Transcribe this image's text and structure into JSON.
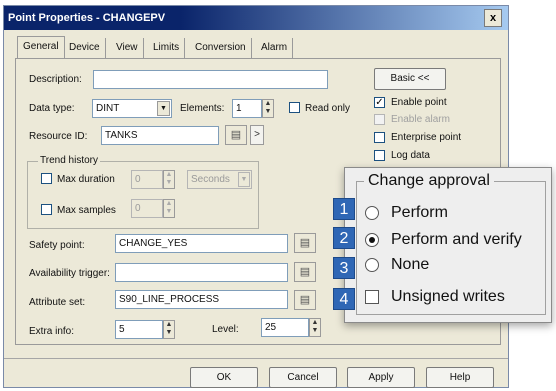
{
  "window": {
    "title": "Point Properties - CHANGEPV",
    "close_glyph": "x"
  },
  "tabs": [
    {
      "label": "General",
      "active": true
    },
    {
      "label": "Device"
    },
    {
      "label": "View"
    },
    {
      "label": "Limits"
    },
    {
      "label": "Conversion"
    },
    {
      "label": "Alarm"
    }
  ],
  "form": {
    "description_label": "Description:",
    "description_value": "",
    "basic_button": "Basic <<",
    "data_type_label": "Data type:",
    "data_type_value": "DINT",
    "elements_label": "Elements:",
    "elements_value": "1",
    "read_only_label": "Read only",
    "resource_id_label": "Resource ID:",
    "resource_id_value": "TANKS",
    "trend_history_label": "Trend history",
    "max_duration_label": "Max duration",
    "max_duration_value": "0",
    "max_duration_unit": "Seconds",
    "max_samples_label": "Max samples",
    "max_samples_value": "0",
    "safety_point_label": "Safety point:",
    "safety_point_value": "CHANGE_YES",
    "availability_trigger_label": "Availability trigger:",
    "availability_trigger_value": "",
    "attribute_set_label": "Attribute set:",
    "attribute_set_value": "S90_LINE_PROCESS",
    "extra_info_label": "Extra info:",
    "extra_info_value": "5",
    "level_label": "Level:",
    "level_value": "25"
  },
  "options": {
    "enable_point": {
      "label": "Enable point",
      "checked": true
    },
    "enable_alarm": {
      "label": "Enable alarm",
      "checked": false,
      "disabled": true
    },
    "enterprise_point": {
      "label": "Enterprise point",
      "checked": false
    },
    "log_data": {
      "label": "Log data",
      "checked": false
    }
  },
  "change_approval": {
    "title": "Change approval",
    "items": [
      {
        "number": "1",
        "label": "Perform",
        "type": "radio",
        "selected": false
      },
      {
        "number": "2",
        "label": "Perform and verify",
        "type": "radio",
        "selected": true
      },
      {
        "number": "3",
        "label": "None",
        "type": "radio",
        "selected": false
      },
      {
        "number": "4",
        "label": "Unsigned writes",
        "type": "checkbox",
        "selected": false
      }
    ]
  },
  "buttons": {
    "ok": "OK",
    "cancel": "Cancel",
    "apply": "Apply",
    "help": "Help"
  },
  "glyphs": {
    "dropdown": "▼",
    "spin_up": "▲",
    "spin_down": "▼",
    "arrow": ">",
    "check": "✓",
    "browse_icon": "▤"
  },
  "colors": {
    "titlebar": "#0a246a",
    "callout_number": "#2f67b5"
  }
}
